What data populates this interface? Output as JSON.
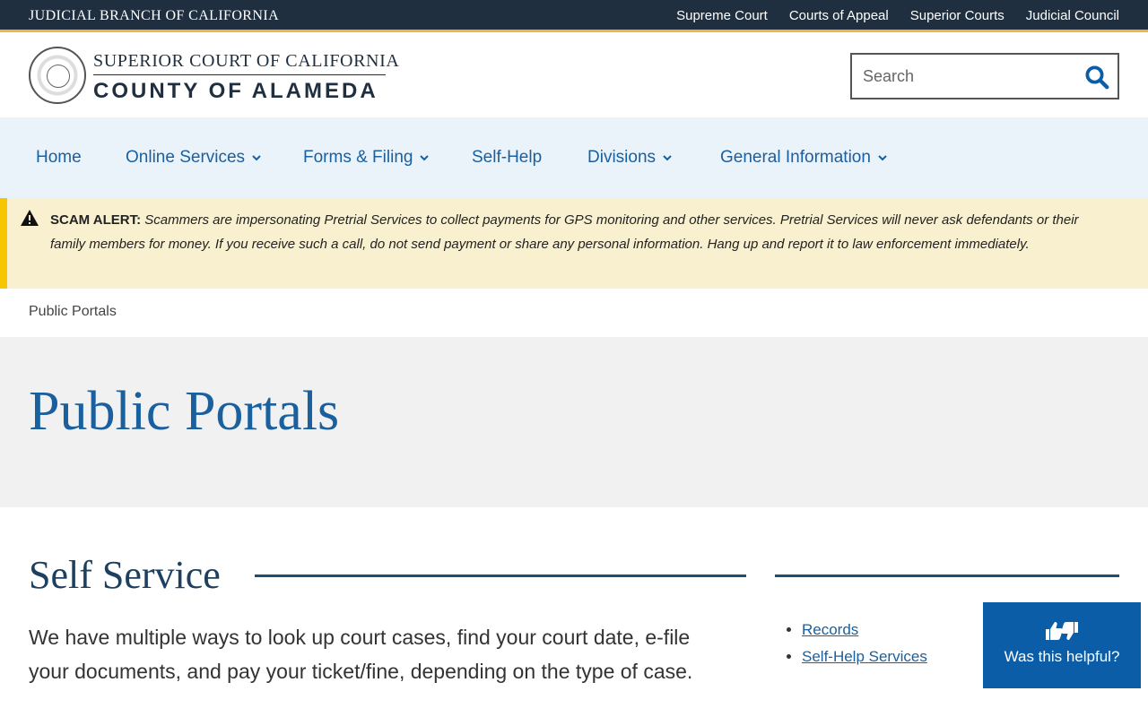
{
  "topbar": {
    "brand": "JUDICIAL BRANCH OF CALIFORNIA",
    "links": [
      "Supreme Court",
      "Courts of Appeal",
      "Superior Courts",
      "Judicial Council"
    ]
  },
  "header": {
    "title_top": "SUPERIOR COURT OF CALIFORNIA",
    "title_bottom": "COUNTY OF ALAMEDA",
    "search_placeholder": "Search"
  },
  "nav": {
    "items": [
      {
        "label": "Home",
        "has_dropdown": false
      },
      {
        "label": "Online Services",
        "has_dropdown": true
      },
      {
        "label": "Forms & Filing",
        "has_dropdown": true
      },
      {
        "label": "Self-Help",
        "has_dropdown": false
      },
      {
        "label": "Divisions",
        "has_dropdown": true
      },
      {
        "label": "General Information",
        "has_dropdown": true
      }
    ]
  },
  "alert": {
    "heading": "SCAM ALERT:",
    "message": " Scammers are impersonating Pretrial Services to collect payments for GPS monitoring and other services.  Pretrial Services will never ask defendants or their family members for money. If you receive such a call, do not send payment or share any personal information.  Hang up and report it to law enforcement immediately."
  },
  "breadcrumb": "Public Portals",
  "hero": {
    "title": "Public Portals"
  },
  "main": {
    "section_title": "Self Service",
    "intro": "We have multiple ways to look up court cases, find your court date, e-file your documents, and pay your ticket/fine, depending on the type of case."
  },
  "sidebar": {
    "links": [
      "Records",
      "Self-Help Services"
    ]
  },
  "helpful": {
    "label": "Was this helpful?"
  },
  "colors": {
    "topbar_bg": "#1f2f3f",
    "accent_gold": "#f2b33d",
    "link_blue": "#1a5f9e",
    "nav_bg": "#eaf2fa",
    "alert_bg": "#f8f0cf",
    "alert_border": "#f7c600",
    "helpful_bg": "#0b5da8"
  },
  "icons": {
    "search": "search-icon",
    "alert": "warning-icon",
    "dropdown": "chevron-down-icon",
    "helpful": "thumbs-up-down-icon"
  }
}
